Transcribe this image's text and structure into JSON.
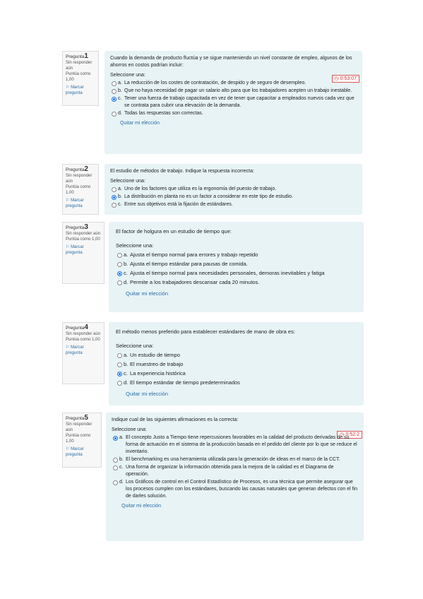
{
  "questions": [
    {
      "label": "Pregunta",
      "number": "1",
      "status": "Sin responder aún",
      "score": "Puntúa como 1,00",
      "flag": "Marcar pregunta",
      "text": "Cuando la demanda de producto fluctúa y se sigue manteniendo un nivel constante de empleo, algunos de los ahorros en costos podrían incluir:",
      "prompt": "Seleccione una:",
      "timer": "0:53:07",
      "options": [
        {
          "letter": "a.",
          "text": "La reducción de los costes de contratación, de despido y de seguro de desempleo."
        },
        {
          "letter": "b.",
          "text": "Que no haya necesidad de pagar un salario alto para que los trabajadores acepten un trabajo inestable."
        },
        {
          "letter": "c.",
          "text": "Tener una fuerza de trabajo capacitada en vez de tener que capacitar a empleados nuevos cada vez que se contrata para cubrir una elevación de la demanda."
        },
        {
          "letter": "d.",
          "text": "Todas las respuestas son correctas."
        }
      ],
      "selected": 2,
      "clear": "Quitar mi elección"
    },
    {
      "label": "Pregunta",
      "number": "2",
      "status": "Sin responder aún",
      "score": "Puntúa como 1,00",
      "flag": "Marcar pregunta",
      "text": "El estudio de métodos de trabajo. Indique la respuesta incorrecta:",
      "prompt": "Seleccione una:",
      "options": [
        {
          "letter": "a.",
          "text": "Uno de los factores que utiliza es la ergonomía del puesto de trabajo."
        },
        {
          "letter": "b.",
          "text": "La distribución en planta no es un factor a considerar en este tipo de estudio."
        },
        {
          "letter": "c.",
          "text": "Entre sus objetivos está la fijación de estándares."
        }
      ],
      "selected": 1
    },
    {
      "label": "Pregunta",
      "number": "3",
      "status": "Sin responder aún",
      "score": "Puntúa como 1,00",
      "flag": "Marcar pregunta",
      "text": "El factor de holgura en un estudio de tiempo que:",
      "prompt": "Seleccione una:",
      "options": [
        {
          "letter": "a.",
          "text": "Ajusta el tiempo normal para errores y trabajo repetido"
        },
        {
          "letter": "b.",
          "text": "Ajusta el tiempo estándar para pausas de comida."
        },
        {
          "letter": "c.",
          "text": "Ajusta el tiempo normal para necesidades personales, demoras inevitables y fatiga"
        },
        {
          "letter": "d.",
          "text": "Permite a los trabajadores descansar cada 20 minutos."
        }
      ],
      "selected": 2,
      "clear": "Quitar mi elección"
    },
    {
      "label": "Pregunta",
      "number": "4",
      "status": "Sin responder aún",
      "score": "Puntúa como 1,00",
      "flag": "Marcar pregunta",
      "text": "El método menos preferido para establecer estándares de mano de obra es:",
      "prompt": "Seleccione una:",
      "options": [
        {
          "letter": "a.",
          "text": "Un estudio de tiempo"
        },
        {
          "letter": "b.",
          "text": "El muestreo de trabajo"
        },
        {
          "letter": "c.",
          "text": "La experiencia histórica"
        },
        {
          "letter": "d.",
          "text": "El tiempo estándar de tiempo predeterminados"
        }
      ],
      "selected": 2,
      "clear": "Quitar mi elección"
    },
    {
      "label": "Pregunta",
      "number": "5",
      "status": "Sin responder aún",
      "score": "Puntúa como 1,00",
      "flag": "Marcar pregunta",
      "text": "Indique cual de las siguientes afirmaciones es la correcta:",
      "prompt": "Seleccione una:",
      "timer": "0:52:2",
      "options": [
        {
          "letter": "a.",
          "text": "El concepto Justo a Tiempo tiene repercusiones favorables en la calidad del producto derivadas de su forma de actuación en el sistema de la producción basada en el pedido del cliente por lo que se reduce el inventario."
        },
        {
          "letter": "b.",
          "text": "El benchmarking es una herramienta utilizada para la generación de ideas en el marco de la CCT."
        },
        {
          "letter": "c.",
          "text": "Una forma de organizar la información obtenida para la mejora de la calidad es el Diagrama de operación."
        },
        {
          "letter": "d.",
          "text": "Los Gráficos de control en el Control Estadístico de Procesos, es una técnica que permite asegurar que los procesos cumplen con los estándares, buscando las causas naturales que generan defectos con el fin de darles solución."
        }
      ],
      "selected": 0,
      "clear": "Quitar mi elección"
    }
  ]
}
